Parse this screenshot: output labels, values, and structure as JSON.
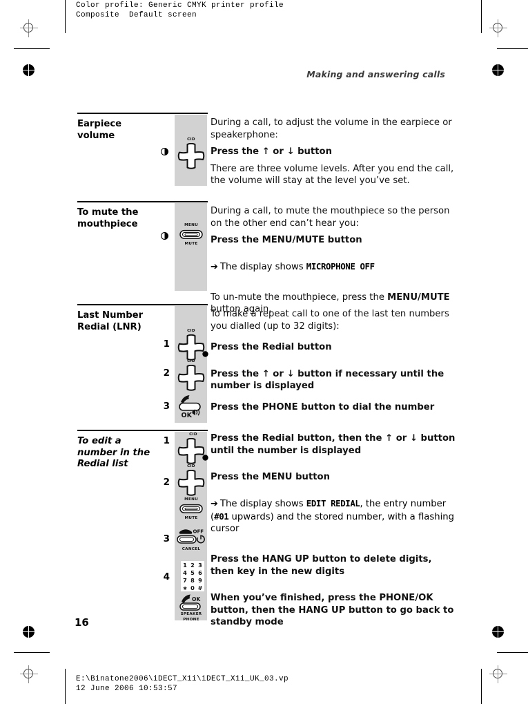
{
  "prepress": {
    "color_profile": "Color profile: Generic CMYK printer profile\nComposite  Default screen",
    "footer_path": "E:\\Binatone2006\\iDECT_X1i\\iDECT_X1i_UK_03.vp\n12 June 2006 10:53:57"
  },
  "page": {
    "running_head": "Making and answering calls",
    "page_number": "16"
  },
  "icons": {
    "cid_label": "CID",
    "menu_label": "MENU",
    "mute_label": "MUTE",
    "ok_label": "OK",
    "off_label": "OFF",
    "cancel_label": "CANCEL",
    "speaker_label": "SPEAKER",
    "phone_label": "PHONE",
    "keypad_rows": [
      [
        "1",
        "2",
        "3"
      ],
      [
        "4",
        "5",
        "6"
      ],
      [
        "7",
        "8",
        "9"
      ],
      [
        "∗",
        "0",
        "#"
      ]
    ]
  },
  "sections": [
    {
      "id": "earpiece-volume",
      "title": "Earpiece\nvolume",
      "italic_title": false,
      "body": {
        "intro": "During a call, to adjust the volume in the earpiece or speakerphone:",
        "instruction_pre": "Press the ",
        "instruction_up": "↑",
        "instruction_or": " or ",
        "instruction_down": "↓",
        "instruction_post": " button",
        "note": "There are three volume levels. After you end the call, the volume will stay at the level you’ve set."
      }
    },
    {
      "id": "mute-mouthpiece",
      "title": "To mute the\nmouthpiece",
      "italic_title": false,
      "body": {
        "intro": "During a call, to mute the mouthpiece so the person on the other end can’t hear you:",
        "instruction_pre": "Press the ",
        "instruction_key": "MENU/MUTE",
        "instruction_post": " button",
        "display_arrow": "➔",
        "display_pre": "The display shows ",
        "display_value": "MICROPHONE  OFF",
        "note_pre": "To un-mute the mouthpiece, press the ",
        "note_key": "MENU/MUTE",
        "note_post": " button again."
      }
    },
    {
      "id": "last-number-redial",
      "title": "Last Number\nRedial (LNR)",
      "italic_title": false,
      "body": {
        "intro": "To make a repeat call to one of the last ten numbers you dialled (up to 32 digits):"
      },
      "steps": [
        {
          "num": "1",
          "pre": "Press the ",
          "key": "Redial",
          "post": " button"
        },
        {
          "num": "2",
          "pre": "Press the ",
          "up": "↑",
          "mid": " or ",
          "down": "↓",
          "post": " button if necessary until the number is displayed"
        },
        {
          "num": "3",
          "pre": "Press the ",
          "key": "PHONE",
          "post": " button to dial the number"
        }
      ]
    },
    {
      "id": "edit-redial-number",
      "title": "To edit a\nnumber in the\nRedial list",
      "italic_title": true,
      "steps": [
        {
          "num": "1",
          "pre": "Press the ",
          "key": "Redial",
          "mid": " button, then the ",
          "up": "↑",
          "or": " or ",
          "down": "↓",
          "post": " button until the number is displayed"
        },
        {
          "num": "2",
          "pre": "Press the ",
          "key": "MENU",
          "post": " button",
          "display_arrow": "➔",
          "display_pre": "The display shows ",
          "display_value": "EDIT REDIAL",
          "display_mid": ", the entry number (",
          "display_value2": "#01",
          "display_post": " upwards) and the stored number, with a flashing cursor"
        },
        {
          "num": "3",
          "pre": "Press the ",
          "key": "HANG UP",
          "post": " button to delete digits, then key in the new digits"
        },
        {
          "num": "4",
          "pre": "When you’ve finished, press the ",
          "key": "PHONE/OK",
          "mid": " button, then the ",
          "key2": "HANG UP",
          "post": " button to go back to standby mode"
        }
      ]
    }
  ]
}
